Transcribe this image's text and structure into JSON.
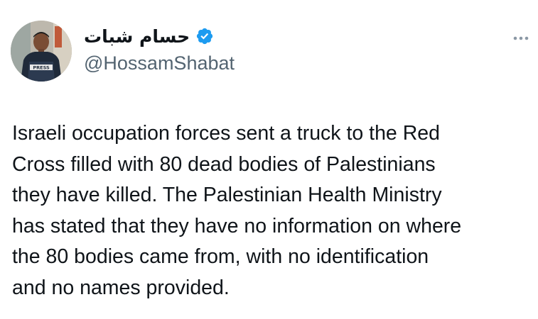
{
  "author": {
    "display_name": "حسام شبات",
    "handle": "@HossamShabat",
    "verified": true,
    "avatar_icon": "avatar-press-vest-photo"
  },
  "tweet": {
    "text": "Israeli occupation forces sent a truck to the Red\nCross filled with 80 dead bodies of Palestinians\nthey have killed. The Palestinian Health Ministry\nhas stated that they have no information on where\nthe 80 bodies came from, with no identification\nand no names provided."
  },
  "icons": {
    "verified": "verified-badge-icon",
    "more": "more-options-icon"
  },
  "colors": {
    "verified_badge": "#1d9bf0",
    "handle": "#536471",
    "text": "#0f1419"
  },
  "avatar_badge_text": "PRESS"
}
